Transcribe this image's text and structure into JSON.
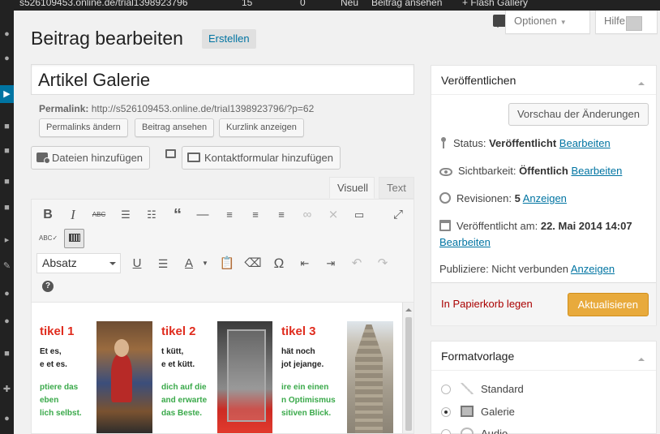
{
  "admin_bar": {
    "site": "s526109453.online.de/trial1398923796",
    "comments_count": "15",
    "pending_count": "0",
    "new_label": "Neu",
    "view_post": "Beitrag ansehen",
    "plugin": "+ Flash Gallery"
  },
  "header": {
    "title": "Beitrag bearbeiten",
    "add_new": "Erstellen",
    "screen_options": "Optionen",
    "help": "Hilfe"
  },
  "post": {
    "title": "Artikel Galerie",
    "permalink_label": "Permalink:",
    "permalink_url": "http://s526109453.online.de/trial1398923796/?p=62",
    "permalink_buttons": [
      "Permalinks ändern",
      "Beitrag ansehen",
      "Kurzlink anzeigen"
    ],
    "add_media": "Dateien hinzufügen",
    "add_form": "Kontaktformular hinzufügen"
  },
  "editor": {
    "tab_visual": "Visuell",
    "tab_text": "Text",
    "format_select": "Absatz",
    "toolbar_icons": [
      "bold-icon",
      "italic-icon",
      "strikethrough-icon",
      "bullet-list-icon",
      "numbered-list-icon",
      "blockquote-icon",
      "horizontal-rule-icon",
      "align-left-icon",
      "align-center-icon",
      "align-right-icon",
      "link-icon",
      "unlink-icon",
      "read-more-icon",
      "fullscreen-icon",
      "spellcheck-icon",
      "kitchen-sink-icon",
      "underline-icon",
      "justify-icon",
      "text-color-icon",
      "paste-text-icon",
      "clear-format-icon",
      "special-char-icon",
      "outdent-icon",
      "indent-icon",
      "undo-icon",
      "redo-icon",
      "help-icon"
    ]
  },
  "content_cards": [
    {
      "title": "tikel 1",
      "black": [
        "Et es,",
        "e et es."
      ],
      "green": [
        "ptiere das",
        "eben",
        "lich selbst."
      ]
    },
    {
      "title": "tikel 2",
      "black": [
        "t kütt,",
        "e et kütt."
      ],
      "green": [
        "dich auf die",
        "and erwarte",
        "das Beste."
      ]
    },
    {
      "title": "tikel 3",
      "black": [
        "hät noch",
        "jot jejange."
      ],
      "green": [
        "ire ein einen",
        "n Optimismus",
        "sitiven Blick."
      ]
    }
  ],
  "publish_box": {
    "title": "Veröffentlichen",
    "preview_button": "Vorschau der Änderungen",
    "status_label": "Status:",
    "status_value": "Veröffentlicht",
    "visibility_label": "Sichtbarkeit:",
    "visibility_value": "Öffentlich",
    "revisions_label": "Revisionen:",
    "revisions_value": "5",
    "published_label": "Veröffentlicht am:",
    "published_value": "22. Mai 2014 14:07",
    "publicize_label": "Publiziere: Nicht verbunden",
    "edit_link": "Bearbeiten",
    "show_link": "Anzeigen",
    "trash": "In Papierkorb legen",
    "update_button": "Aktualisieren"
  },
  "format_box": {
    "title": "Formatvorlage",
    "options": [
      "Standard",
      "Galerie",
      "Audio"
    ],
    "selected": "Galerie"
  },
  "colors": {
    "accent": "#0074a2",
    "primary_button": "#e8aa3c",
    "trash": "#aa0000",
    "card_title": "#e02c1e",
    "card_green": "#3aa94a"
  }
}
